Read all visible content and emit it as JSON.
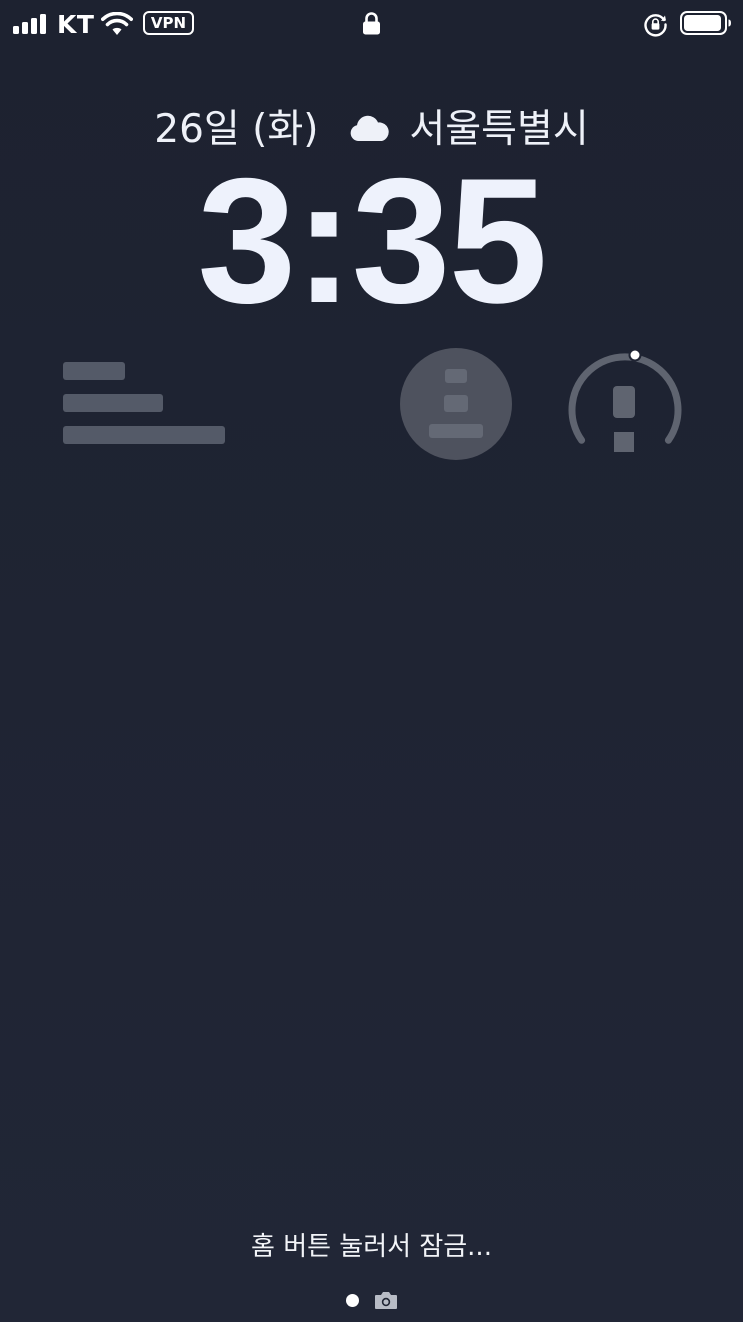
{
  "status_bar": {
    "carrier": "KT",
    "vpn_label": "VPN",
    "icons": [
      "cellular-signal-icon",
      "wifi-icon",
      "vpn-badge",
      "lock-icon",
      "rotation-lock-icon",
      "battery-icon"
    ],
    "signal_bars": 4,
    "battery_level": 0.9
  },
  "lock_screen": {
    "date": "26일 (화)",
    "weather_icon": "cloud-icon",
    "location": "서울특별시",
    "time": "3:35"
  },
  "widgets": {
    "left_icon": "text-widget-icon",
    "middle_icon": "contact-widget-icon",
    "right_icon": "alert-gauge-icon"
  },
  "bottom": {
    "unlock_hint": "홈 버튼 눌러서 잠금...",
    "page_indicator_icon": "page-dot-icon",
    "camera_icon": "camera-icon"
  },
  "colors": {
    "background": "#1f2433",
    "widget_fill": "#545a68",
    "text": "#eef1f8"
  }
}
